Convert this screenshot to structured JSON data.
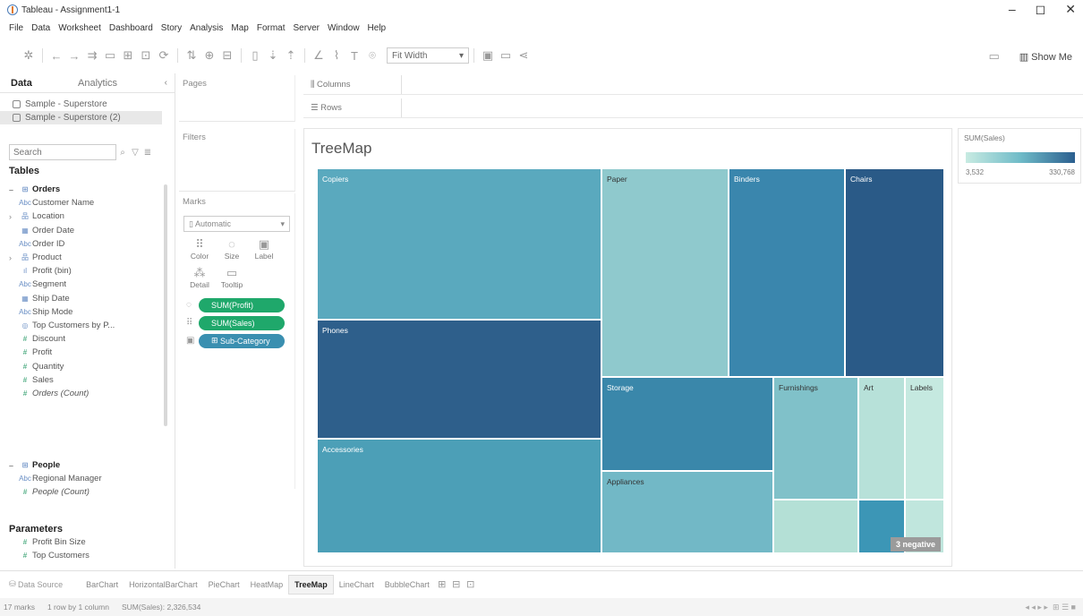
{
  "window": {
    "title": "Tableau - Assignment1-1",
    "controls": [
      "–",
      "◻",
      "✕"
    ]
  },
  "menu": [
    "File",
    "Data",
    "Worksheet",
    "Dashboard",
    "Story",
    "Analysis",
    "Map",
    "Format",
    "Server",
    "Window",
    "Help"
  ],
  "toolbar": {
    "fit": "Fit Width",
    "show_me": "Show Me"
  },
  "data_pane": {
    "tabs": [
      "Data",
      "Analytics"
    ],
    "sources": [
      "Sample - Superstore",
      "Sample - Superstore (2)"
    ],
    "search_placeholder": "Search",
    "tables_title": "Tables",
    "orders": {
      "name": "Orders",
      "fields": [
        {
          "label": "Customer Name",
          "type": "Abc",
          "exp": ""
        },
        {
          "label": "Location",
          "type": "品",
          "exp": "›"
        },
        {
          "label": "Order Date",
          "type": "▦",
          "exp": ""
        },
        {
          "label": "Order ID",
          "type": "Abc",
          "exp": ""
        },
        {
          "label": "Product",
          "type": "品",
          "exp": "›"
        },
        {
          "label": "Profit (bin)",
          "type": "ıl",
          "exp": ""
        },
        {
          "label": "Segment",
          "type": "Abc",
          "exp": ""
        },
        {
          "label": "Ship Date",
          "type": "▦",
          "exp": ""
        },
        {
          "label": "Ship Mode",
          "type": "Abc",
          "exp": ""
        },
        {
          "label": "Top Customers by P...",
          "type": "◎",
          "exp": ""
        },
        {
          "label": "Discount",
          "type": "#",
          "exp": ""
        },
        {
          "label": "Profit",
          "type": "#",
          "exp": ""
        },
        {
          "label": "Quantity",
          "type": "#",
          "exp": ""
        },
        {
          "label": "Sales",
          "type": "#",
          "exp": ""
        },
        {
          "label": "Orders (Count)",
          "type": "#",
          "exp": ""
        }
      ]
    },
    "people": {
      "name": "People",
      "fields": [
        {
          "label": "Regional Manager",
          "type": "Abc"
        },
        {
          "label": "People (Count)",
          "type": "#"
        }
      ]
    },
    "parameters_title": "Parameters",
    "parameters": [
      "Profit Bin Size",
      "Top Customers"
    ]
  },
  "cards": {
    "pages": "Pages",
    "filters": "Filters",
    "marks": "Marks",
    "mark_type": "Automatic",
    "mark_buttons": [
      {
        "label": "Color",
        "glyph": "⠿"
      },
      {
        "label": "Size",
        "glyph": "◌"
      },
      {
        "label": "Label",
        "glyph": "▣"
      },
      {
        "label": "Detail",
        "glyph": "⁂"
      },
      {
        "label": "Tooltip",
        "glyph": "▭"
      }
    ],
    "pills": [
      {
        "icon": "◌",
        "label": "SUM(Profit)",
        "color": "green"
      },
      {
        "icon": "⠿",
        "label": "SUM(Sales)",
        "color": "green"
      },
      {
        "icon": "▣",
        "label": "Sub-Category",
        "color": "blue"
      }
    ]
  },
  "shelves": {
    "columns": "Columns",
    "rows": "Rows"
  },
  "view": {
    "title": "TreeMap",
    "negatives_badge": "3 negative"
  },
  "legend": {
    "title": "SUM(Sales)",
    "min": "3,532",
    "max": "330,768"
  },
  "chart_data": {
    "type": "treemap",
    "title": "TreeMap",
    "size_measure": "SUM(Profit)",
    "color_measure": "SUM(Sales)",
    "detail": "Sub-Category",
    "color_range": [
      "#c8ebe2",
      "#2b5f8f"
    ],
    "tiles": [
      {
        "label": "Copiers",
        "color": "#5aa9be"
      },
      {
        "label": "Phones",
        "color": "#2e5f8b"
      },
      {
        "label": "Accessories",
        "color": "#4c9fb7"
      },
      {
        "label": "Paper",
        "color": "#8fc9cd"
      },
      {
        "label": "Binders",
        "color": "#3a86ad"
      },
      {
        "label": "Chairs",
        "color": "#2a5a87"
      },
      {
        "label": "Storage",
        "color": "#3a87aa"
      },
      {
        "label": "Appliances",
        "color": "#72b8c6"
      },
      {
        "label": "Furnishings",
        "color": "#80c1c9"
      },
      {
        "label": "Art",
        "color": "#b7e1d9"
      },
      {
        "label": "Labels",
        "color": "#c5e9e0"
      },
      {
        "label": "",
        "color": "#b4e0d6"
      },
      {
        "label": "",
        "color": "#3c96b6"
      },
      {
        "label": "",
        "color": "#c0e6dd"
      }
    ]
  },
  "sheet_tabs": {
    "data_source": "Data Source",
    "sheets": [
      "BarChart",
      "HorizontalBarChart",
      "PieChart",
      "HeatMap",
      "TreeMap",
      "LineChart",
      "BubbleChart"
    ],
    "active": "TreeMap"
  },
  "status": {
    "marks": "17 marks",
    "dims": "1 row by 1 column",
    "sum": "SUM(Sales): 2,326,534"
  }
}
